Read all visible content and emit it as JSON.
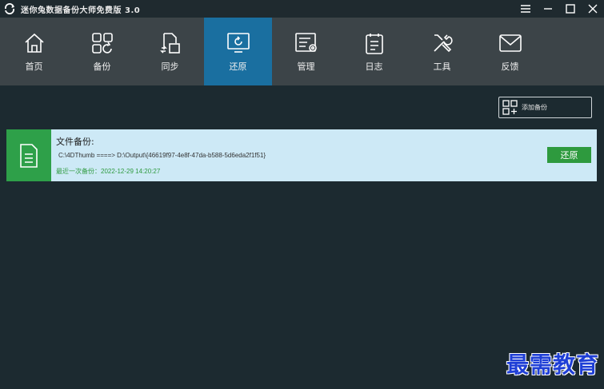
{
  "window": {
    "title": "迷你兔数据备份大师免费版 3.0",
    "controls": [
      "menu-icon",
      "minimize-icon",
      "maximize-icon",
      "close-icon"
    ]
  },
  "toolbar": {
    "items": [
      {
        "label": "首页",
        "icon": "home-icon",
        "active": false
      },
      {
        "label": "备份",
        "icon": "backup-icon",
        "active": false
      },
      {
        "label": "同步",
        "icon": "sync-icon",
        "active": false
      },
      {
        "label": "还原",
        "icon": "restore-icon",
        "active": true
      },
      {
        "label": "管理",
        "icon": "manage-icon",
        "active": false
      },
      {
        "label": "日志",
        "icon": "log-icon",
        "active": false
      },
      {
        "label": "工具",
        "icon": "tools-icon",
        "active": false
      },
      {
        "label": "反馈",
        "icon": "feedback-icon",
        "active": false
      }
    ],
    "active_color": "#1a6fa0"
  },
  "actions": {
    "add_backup_label": "添加备份"
  },
  "backup": {
    "title": "文件备份:",
    "path": "C:\\4DThumb ====> D:\\Output\\{46619f97-4e8f-47da-b588-5d6eda2f1f51}",
    "last_backup": "最近一次备份：2022-12-29 14:20:27",
    "restore_label": "还原",
    "accent_color": "#2ea049"
  },
  "watermark": "最需教育"
}
